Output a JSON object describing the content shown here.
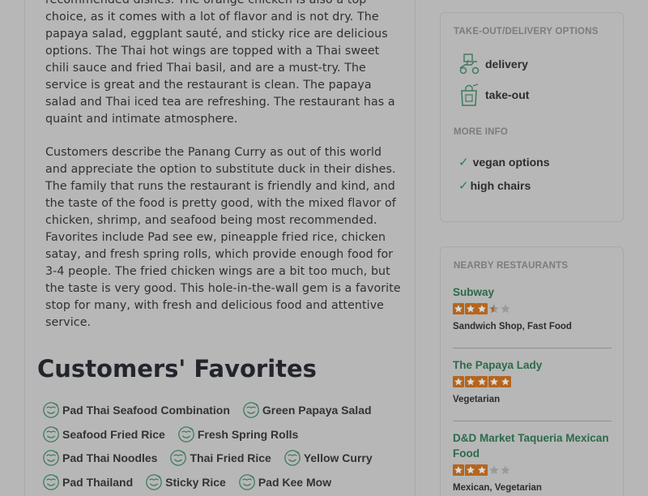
{
  "review_summary": {
    "paragraphs": [
      "recommended dishes. The orange chicken is also a top choice, as it comes with a lot of flavor and is not dry. The papaya salad, eggplant sauté, and sticky rice are delicious options. The Thai hot wings are topped with a Thai sweet chili sauce and fried Thai basil, and are a must-try. The service is great and the restaurant is clean. The papaya salad and Thai iced tea are refreshing. The restaurant has a quaint and intimate atmosphere.",
      "Customers describe the Panang Curry as out of this world and appreciate the option to substitute duck in their dishes. The family that runs the restaurant is friendly and kind, and the taste of the food is pretty good, with the mixed flavor of chicken, shrimp, and seafood being most recommended. Favorites include Pad see ew, pineapple fried rice, chicken satay, and fresh spring rolls, which provide enough food for 3-4 people. The fried chicken wings are a bit too much, but the taste is very good. This hole-in-the-wall gem is a favorite stop for many, with fresh and delicious food and attentive service."
    ]
  },
  "favorites": {
    "title": "Customers' Favorites",
    "icon": "smiling-dish-icon",
    "rows": [
      [
        "Pad Thai Seafood Combination",
        "Green Papaya Salad"
      ],
      [
        "Seafood Fried Rice",
        "Fresh Spring Rolls"
      ],
      [
        "Pad Thai Noodles",
        "Thai Fried Rice",
        "Yellow Curry"
      ],
      [
        "Pad Thailand",
        "Sticky Rice",
        "Pad Kee Mow"
      ]
    ]
  },
  "takeout": {
    "heading": "TAKE-OUT/DELIVERY OPTIONS",
    "options": [
      {
        "label": "delivery",
        "icon": "delivery-scooter-icon"
      },
      {
        "label": "take-out",
        "icon": "takeout-bag-icon"
      }
    ]
  },
  "more_info": {
    "heading": "MORE INFO",
    "items": [
      "vegan options",
      "high chairs"
    ]
  },
  "nearby": {
    "heading": "NEARBY RESTAURANTS",
    "restaurants": [
      {
        "name": "Subway",
        "rating": 3.5,
        "categories": "Sandwich Shop, Fast Food"
      },
      {
        "name": "The Papaya Lady",
        "rating": 5,
        "categories": "Vegetarian"
      },
      {
        "name": "D&D Market Taqueria Mexican Food",
        "rating": 3,
        "categories": "Mexican, Vegetarian"
      }
    ]
  },
  "colors": {
    "overlay_background": "#b7b7b7",
    "accent_green": "#2c6a4a",
    "star_orange": "#b5651d",
    "star_empty": "#9a9a9a"
  }
}
